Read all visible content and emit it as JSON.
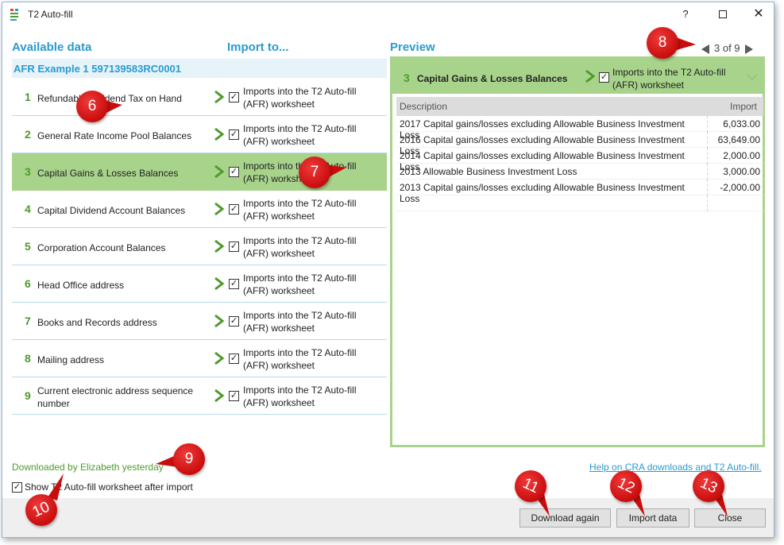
{
  "window": {
    "title": "T2 Auto-fill",
    "help_glyph": "?",
    "close_glyph": "✕"
  },
  "headings": {
    "available": "Available data",
    "import_to": "Import to...",
    "preview": "Preview"
  },
  "pager": {
    "text": "3 of 9"
  },
  "company": "AFR Example 1 597139583RC0001",
  "rows": [
    {
      "num": "1",
      "name": "Refundable Dividend Tax on Hand",
      "import_text": "Imports into the T2 Auto-fill (AFR) worksheet"
    },
    {
      "num": "2",
      "name": "General Rate Income Pool Balances",
      "import_text": "Imports into the T2 Auto-fill (AFR) worksheet"
    },
    {
      "num": "3",
      "name": "Capital Gains & Losses Balances",
      "import_text": "Imports into the T2 Auto-fill (AFR) worksheet"
    },
    {
      "num": "4",
      "name": "Capital Dividend Account Balances",
      "import_text": "Imports into the T2 Auto-fill (AFR) worksheet"
    },
    {
      "num": "5",
      "name": "Corporation Account Balances",
      "import_text": "Imports into the T2 Auto-fill (AFR) worksheet"
    },
    {
      "num": "6",
      "name": "Head Office address",
      "import_text": "Imports into the T2 Auto-fill (AFR) worksheet"
    },
    {
      "num": "7",
      "name": "Books and Records address",
      "import_text": "Imports into the T2 Auto-fill (AFR) worksheet"
    },
    {
      "num": "8",
      "name": "Mailing address",
      "import_text": "Imports into the T2 Auto-fill (AFR) worksheet"
    },
    {
      "num": "9",
      "name": "Current electronic address sequence number",
      "import_text": "Imports into the T2 Auto-fill (AFR) worksheet"
    }
  ],
  "preview": {
    "num": "3",
    "name": "Capital Gains & Losses Balances",
    "import_text": "Imports into the T2 Auto-fill (AFR) worksheet",
    "columns": [
      "Description",
      "Import"
    ],
    "rows": [
      {
        "description": "2017 Capital gains/losses excluding Allowable Business Investment Loss",
        "value": "6,033.00"
      },
      {
        "description": "2016 Capital gains/losses excluding Allowable Business Investment Loss",
        "value": "63,649.00"
      },
      {
        "description": "2014 Capital gains/losses excluding Allowable Business Investment Loss",
        "value": "2,000.00"
      },
      {
        "description": "2013 Allowable Business Investment Loss",
        "value": "3,000.00"
      },
      {
        "description": "2013 Capital gains/losses excluding Allowable Business Investment Loss",
        "value": "-2,000.00"
      }
    ]
  },
  "status": {
    "downloaded": "Downloaded by Elizabeth yesterday",
    "help_link": "Help on CRA downloads and T2 Auto-fill.",
    "show_worksheet": "Show T2 Auto-fill worksheet after import"
  },
  "buttons": {
    "download_again": "Download again",
    "import_data": "Import data",
    "close": "Close"
  },
  "checkmark": "✓",
  "callouts": [
    "6",
    "7",
    "8",
    "9",
    "10",
    "11",
    "12",
    "13"
  ],
  "colors": {
    "accent_blue": "#2a9bd0",
    "accent_green": "#4f9a2d",
    "selection_green": "#a8d38b",
    "callout_red": "#d61313"
  }
}
